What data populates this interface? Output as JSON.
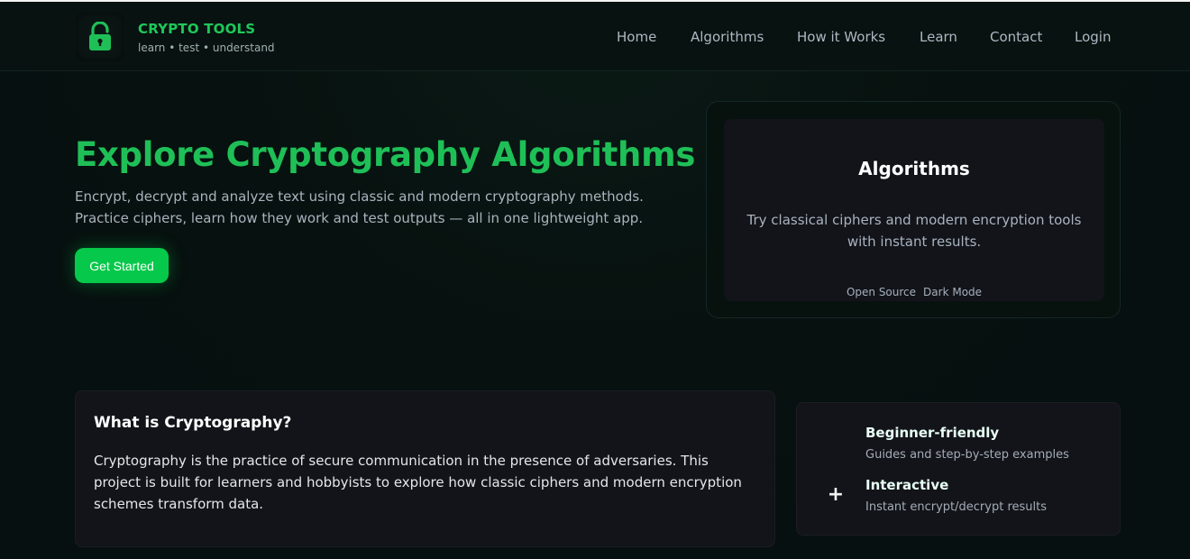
{
  "header": {
    "brand_title": "CRYPTO TOOLS",
    "brand_subtitle": "learn • test • understand",
    "logo_icon": "lock-icon",
    "nav": [
      "Home",
      "Algorithms",
      "How it Works",
      "Learn",
      "Contact",
      "Login"
    ]
  },
  "hero": {
    "title": "Explore Cryptography Algorithms",
    "description": "Encrypt, decrypt and analyze text using classic and modern cryptography methods. Practice ciphers, learn how they work and test outputs — all in one lightweight app.",
    "cta_label": "Get Started"
  },
  "algorithms_card": {
    "title": "Algorithms",
    "description": "Try classical ciphers and modern encryption tools with instant results.",
    "tags": [
      "Open Source",
      "Dark Mode"
    ]
  },
  "what_is": {
    "title": "What is Cryptography?",
    "body": "Cryptography is the practice of secure communication in the presence of adversaries. This project is built for learners and hobbyists to explore how classic ciphers and modern encryption schemes transform data."
  },
  "features": {
    "icon": "plus-icon",
    "items": [
      {
        "title": "Beginner-friendly",
        "subtitle": "Guides and step-by-step examples"
      },
      {
        "title": "Interactive",
        "subtitle": "Instant encrypt/decrypt results"
      }
    ]
  },
  "colors": {
    "accent": "#1fbf57",
    "button": "#06c84a",
    "background": "#07110f",
    "card": "#131419"
  }
}
